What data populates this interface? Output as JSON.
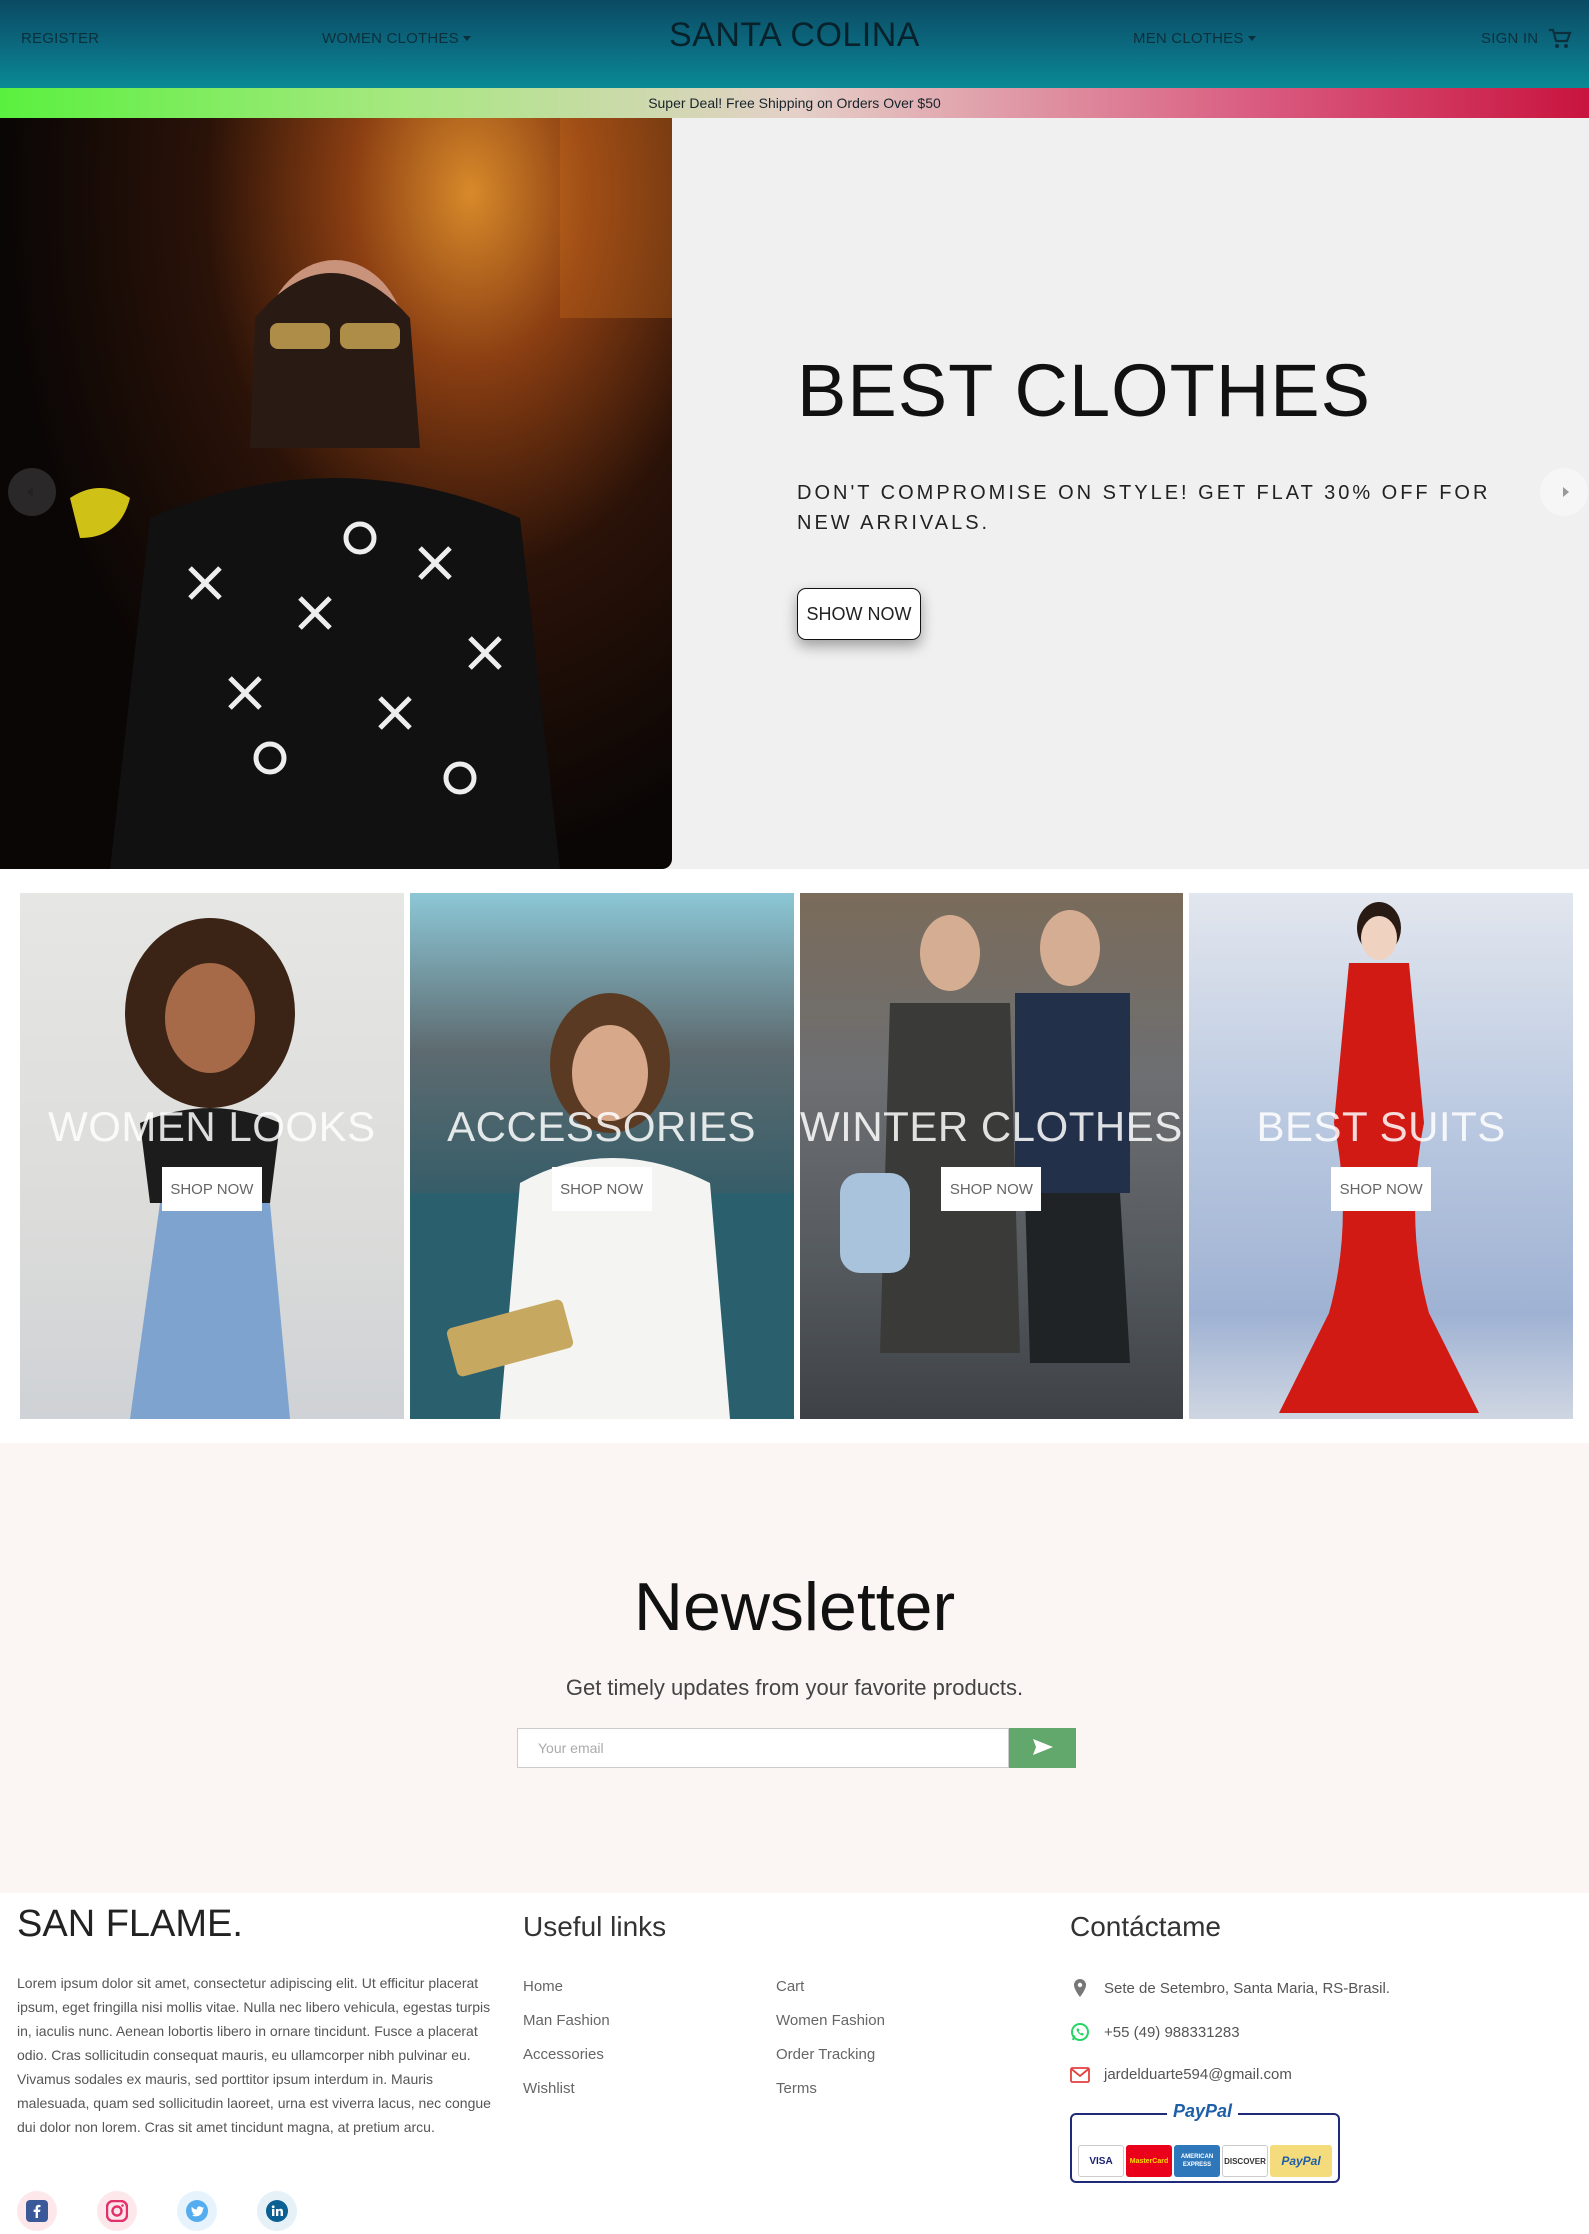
{
  "nav": {
    "register": "REGISTER",
    "women_clothes": "WOMEN CLOTHES",
    "brand": "SANTA COLINA",
    "men_clothes": "MEN CLOTHES",
    "sign_in": "SIGN IN",
    "cart_icon": "cart-icon"
  },
  "promo": {
    "text": "Super Deal! Free Shipping on Orders Over $50"
  },
  "hero": {
    "title": "BEST CLOTHES",
    "subtitle": "DON'T COMPROMISE ON STYLE! GET FLAT 30% OFF FOR NEW ARRIVALS.",
    "button": "SHOW NOW"
  },
  "categories": [
    {
      "title": "WOMEN LOOKS",
      "button": "SHOP NOW"
    },
    {
      "title": "ACCESSORIES",
      "button": "SHOP NOW"
    },
    {
      "title": "WINTER CLOTHES",
      "button": "SHOP NOW"
    },
    {
      "title": "BEST SUITS",
      "button": "SHOP NOW"
    }
  ],
  "newsletter": {
    "title": "Newsletter",
    "subtitle": "Get timely updates from your favorite products.",
    "placeholder": "Your email"
  },
  "footer": {
    "brand": "SAN FLAME.",
    "about": "Lorem ipsum dolor sit amet, consectetur adipiscing elit. Ut efficitur placerat ipsum, eget fringilla nisi mollis vitae. Nulla nec libero vehicula, egestas turpis in, iaculis nunc. Aenean lobortis libero in ornare tincidunt. Fusce a placerat odio. Cras sollicitudin consequat mauris, eu ullamcorper nibh pulvinar eu. Vivamus sodales ex mauris, sed porttitor ipsum interdum in. Mauris malesuada, quam sed sollicitudin laoreet, urna est viverra lacus, nec congue dui dolor non lorem. Cras sit amet tincidunt magna, at pretium arcu.",
    "useful_links_title": "Useful links",
    "links_col1": [
      "Home",
      "Man Fashion",
      "Accessories",
      "Wishlist"
    ],
    "links_col2": [
      "Cart",
      "Women Fashion",
      "Order Tracking",
      "Terms"
    ],
    "contact_title": "Contáctame",
    "address": "Sete de Setembro, Santa Maria, RS-Brasil.",
    "phone": "+55 (49) 988331283",
    "email": "jardelduarte594@gmail.com",
    "paypal_label": "PayPal",
    "cards": [
      "VISA",
      "MasterCard",
      "AMERICAN EXPRESS",
      "DISCOVER",
      "PayPal"
    ],
    "social_icons": [
      "facebook-icon",
      "instagram-icon",
      "twitter-icon",
      "linkedin-icon"
    ]
  },
  "colors": {
    "nav_top": "#0b4a63",
    "nav_bottom": "#0a8a94",
    "newsletter_bg": "#fbf5f4",
    "send_button": "#62a86d",
    "facebook": "#3b5998",
    "instagram": "#e1306c",
    "twitter": "#55acee",
    "linkedin": "#0077b5"
  }
}
